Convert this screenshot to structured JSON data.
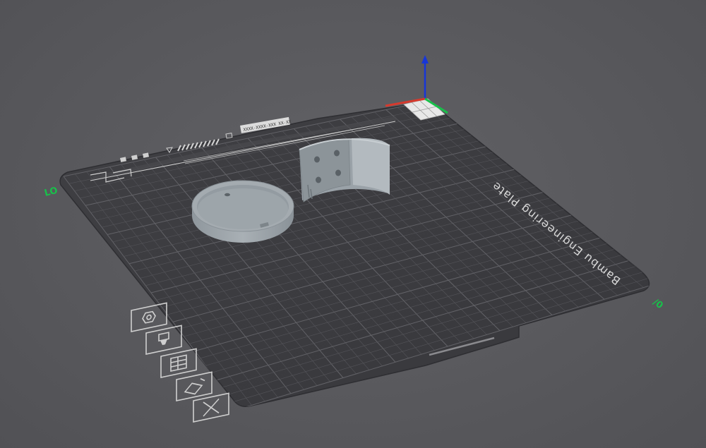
{
  "app": {
    "view": "3D prepare viewport"
  },
  "plate": {
    "name": "Bambu Engineering Plate",
    "corner_labels": {
      "left": "LO",
      "right": "/0"
    },
    "header_strip_text": "XXXX-XXXX-XXX XX-XX"
  },
  "axes": {
    "x_color": "#d63a2e",
    "y_color": "#18c04a",
    "z_color": "#1736d8"
  },
  "objects": [
    {
      "name": "round-lid",
      "kind": "cylindrical tray"
    },
    {
      "name": "curved-bracket",
      "kind": "curved mount with four holes"
    }
  ],
  "plate_markings": {
    "icons": [
      "hexagon-nut-icon",
      "nozzle-icon",
      "layers-grid-icon",
      "wipe-tower-icon",
      "excluded-zone-icon"
    ]
  },
  "colors": {
    "background": "#5a5a5e",
    "plate_surface": "#3d3d41",
    "grid_line": "#55555a",
    "object_color": "#9aa2a8"
  }
}
